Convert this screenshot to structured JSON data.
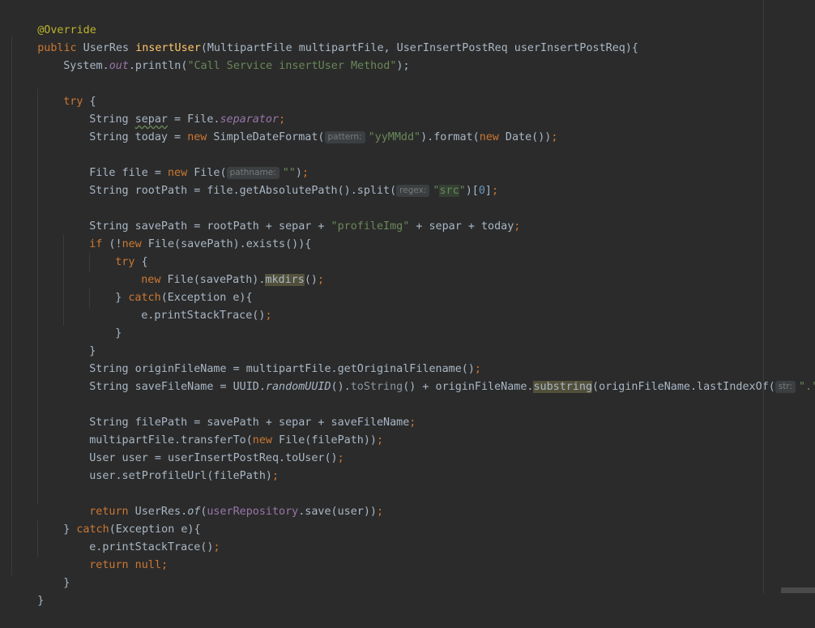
{
  "editor": {
    "l1_ann": "@Override",
    "l2_public": "public",
    "l2_ret": " UserRes ",
    "l2_method": "insertUser",
    "l2_params": "(MultipartFile multipartFile, UserInsertPostReq userInsertPostReq){",
    "l3_a": "System.",
    "l3_out": "out",
    "l3_b": ".println(",
    "l3_str": "\"Call Service insertUser Method\"",
    "l3_c": ");",
    "l5_try": "try",
    "l5_brace": " {",
    "l6_a": "String ",
    "l6_var": "separ",
    "l6_b": " = File.",
    "l6_fld": "separator",
    "l6_semi": ";",
    "l7_a": "String today = ",
    "l7_new": "new",
    "l7_b": " SimpleDateFormat(",
    "l7_hint": "pattern:",
    "l7_str": "\"yyMMdd\"",
    "l7_c": ").format(",
    "l7_new2": "new",
    "l7_d": " Date())",
    "l7_semi": ";",
    "l9_a": "File file = ",
    "l9_new": "new",
    "l9_b": " File(",
    "l9_hint": "pathname:",
    "l9_str": "\"\"",
    "l9_c": ")",
    "l9_semi": ";",
    "l10_a": "String rootPath = file.getAbsolutePath().split(",
    "l10_hint": "regex:",
    "l10_str_q1": "\"",
    "l10_str_src": "src",
    "l10_str_q2": "\"",
    "l10_b": ")[",
    "l10_num": "0",
    "l10_c": "]",
    "l10_semi": ";",
    "l12_a": "String savePath = rootPath + separ + ",
    "l12_str": "\"profileImg\"",
    "l12_b": " + separ + today",
    "l12_semi": ";",
    "l13_if": "if",
    "l13_a": " (!",
    "l13_new": "new",
    "l13_b": " File(savePath).exists()){",
    "l14_try": "try",
    "l14_brace": " {",
    "l15_new": "new",
    "l15_a": " File(savePath).",
    "l15_mk": "mkdirs",
    "l15_b": "()",
    "l15_semi": ";",
    "l16_a": "} ",
    "l16_catch": "catch",
    "l16_b": "(Exception e){",
    "l17_a": "e.printStackTrace()",
    "l17_semi": ";",
    "l18_a": "}",
    "l19_a": "}",
    "l20_a": "String originFileName = multipartFile.getOriginalFilename()",
    "l20_semi": ";",
    "l21_a": "String saveFileName = UUID.",
    "l21_rand": "randomUUID",
    "l21_b": "().",
    "l21_tostr": "toString",
    "l21_c": "() + originFileName.",
    "l21_sub": "substring",
    "l21_d": "(originFileName.lastIndexOf(",
    "l21_hint": "str:",
    "l21_str": "\".\"",
    "l21_e": "))",
    "l21_semi": ";",
    "l23_a": "String filePath = savePath + separ + saveFileName",
    "l23_semi": ";",
    "l24_a": "multipartFile.transferTo(",
    "l24_new": "new",
    "l24_b": " File(filePath))",
    "l24_semi": ";",
    "l25_a": "User user = userInsertPostReq.toUser()",
    "l25_semi": ";",
    "l26_a": "user.setProfileUrl(filePath)",
    "l26_semi": ";",
    "l28_ret": "return",
    "l28_a": " UserRes.",
    "l28_of": "of",
    "l28_b": "(",
    "l28_repo": "userRepository",
    "l28_c": ".save(user))",
    "l28_semi": ";",
    "l29_a": "} ",
    "l29_catch": "catch",
    "l29_b": "(Exception e){",
    "l30_a": "e.printStackTrace()",
    "l30_semi": ";",
    "l31_ret": "return",
    "l31_null": " null",
    "l31_semi": ";",
    "l32_a": "}",
    "l33_a": "}"
  },
  "colors": {
    "background": "#2b2b2b",
    "keyword": "#cc7832",
    "annotation": "#bbb529",
    "method": "#ffc66d",
    "string": "#6a8759",
    "number": "#6897bb",
    "field": "#9876aa",
    "text": "#a9b7c6"
  }
}
